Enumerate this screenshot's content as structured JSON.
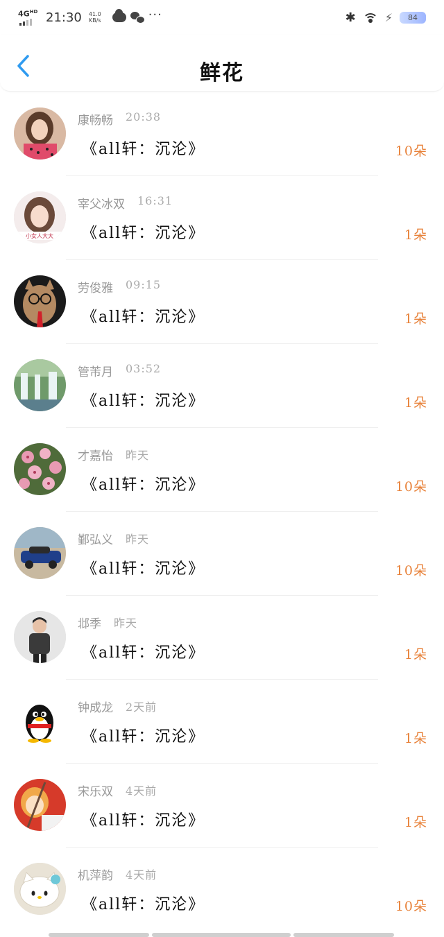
{
  "status_bar": {
    "network": "4G",
    "network_sup": "HD",
    "time": "21:30",
    "speed_value": "41.0",
    "speed_unit": "KB/s",
    "battery": "84"
  },
  "header": {
    "title": "鲜花"
  },
  "items": [
    {
      "name": "康畅畅",
      "time": "20:38",
      "message": "《all轩：沉沦》",
      "count": "10朵",
      "avatar": "woman-selfie"
    },
    {
      "name": "宰父冰双",
      "time": "16:31",
      "message": "《all轩：沉沦》",
      "count": "1朵",
      "avatar": "girl-portrait",
      "avatar_caption": "小女人大大"
    },
    {
      "name": "劳俊雅",
      "time": "09:15",
      "message": "《all轩：沉沦》",
      "count": "1朵",
      "avatar": "cat-with-glasses"
    },
    {
      "name": "管芾月",
      "time": "03:52",
      "message": "《all轩：沉沦》",
      "count": "1朵",
      "avatar": "waterfall"
    },
    {
      "name": "才嘉怡",
      "time": "昨天",
      "message": "《all轩：沉沦》",
      "count": "10朵",
      "avatar": "pink-flowers"
    },
    {
      "name": "鄞弘义",
      "time": "昨天",
      "message": "《all轩：沉沦》",
      "count": "10朵",
      "avatar": "rally-car"
    },
    {
      "name": "邶季",
      "time": "昨天",
      "message": "《all轩：沉沦》",
      "count": "1朵",
      "avatar": "man-in-sweater"
    },
    {
      "name": "钟成龙",
      "time": "2天前",
      "message": "《all轩：沉沦》",
      "count": "1朵",
      "avatar": "qq-penguin"
    },
    {
      "name": "宋乐双",
      "time": "4天前",
      "message": "《all轩：沉沦》",
      "count": "1朵",
      "avatar": "cartoon-girl"
    },
    {
      "name": "机萍韵",
      "time": "4天前",
      "message": "《all轩：沉沦》",
      "count": "10朵",
      "avatar": "hello-kitty"
    }
  ],
  "colors": {
    "accent_blue": "#2f9bf0",
    "count_orange": "#e8823a",
    "meta_gray": "#999999"
  }
}
